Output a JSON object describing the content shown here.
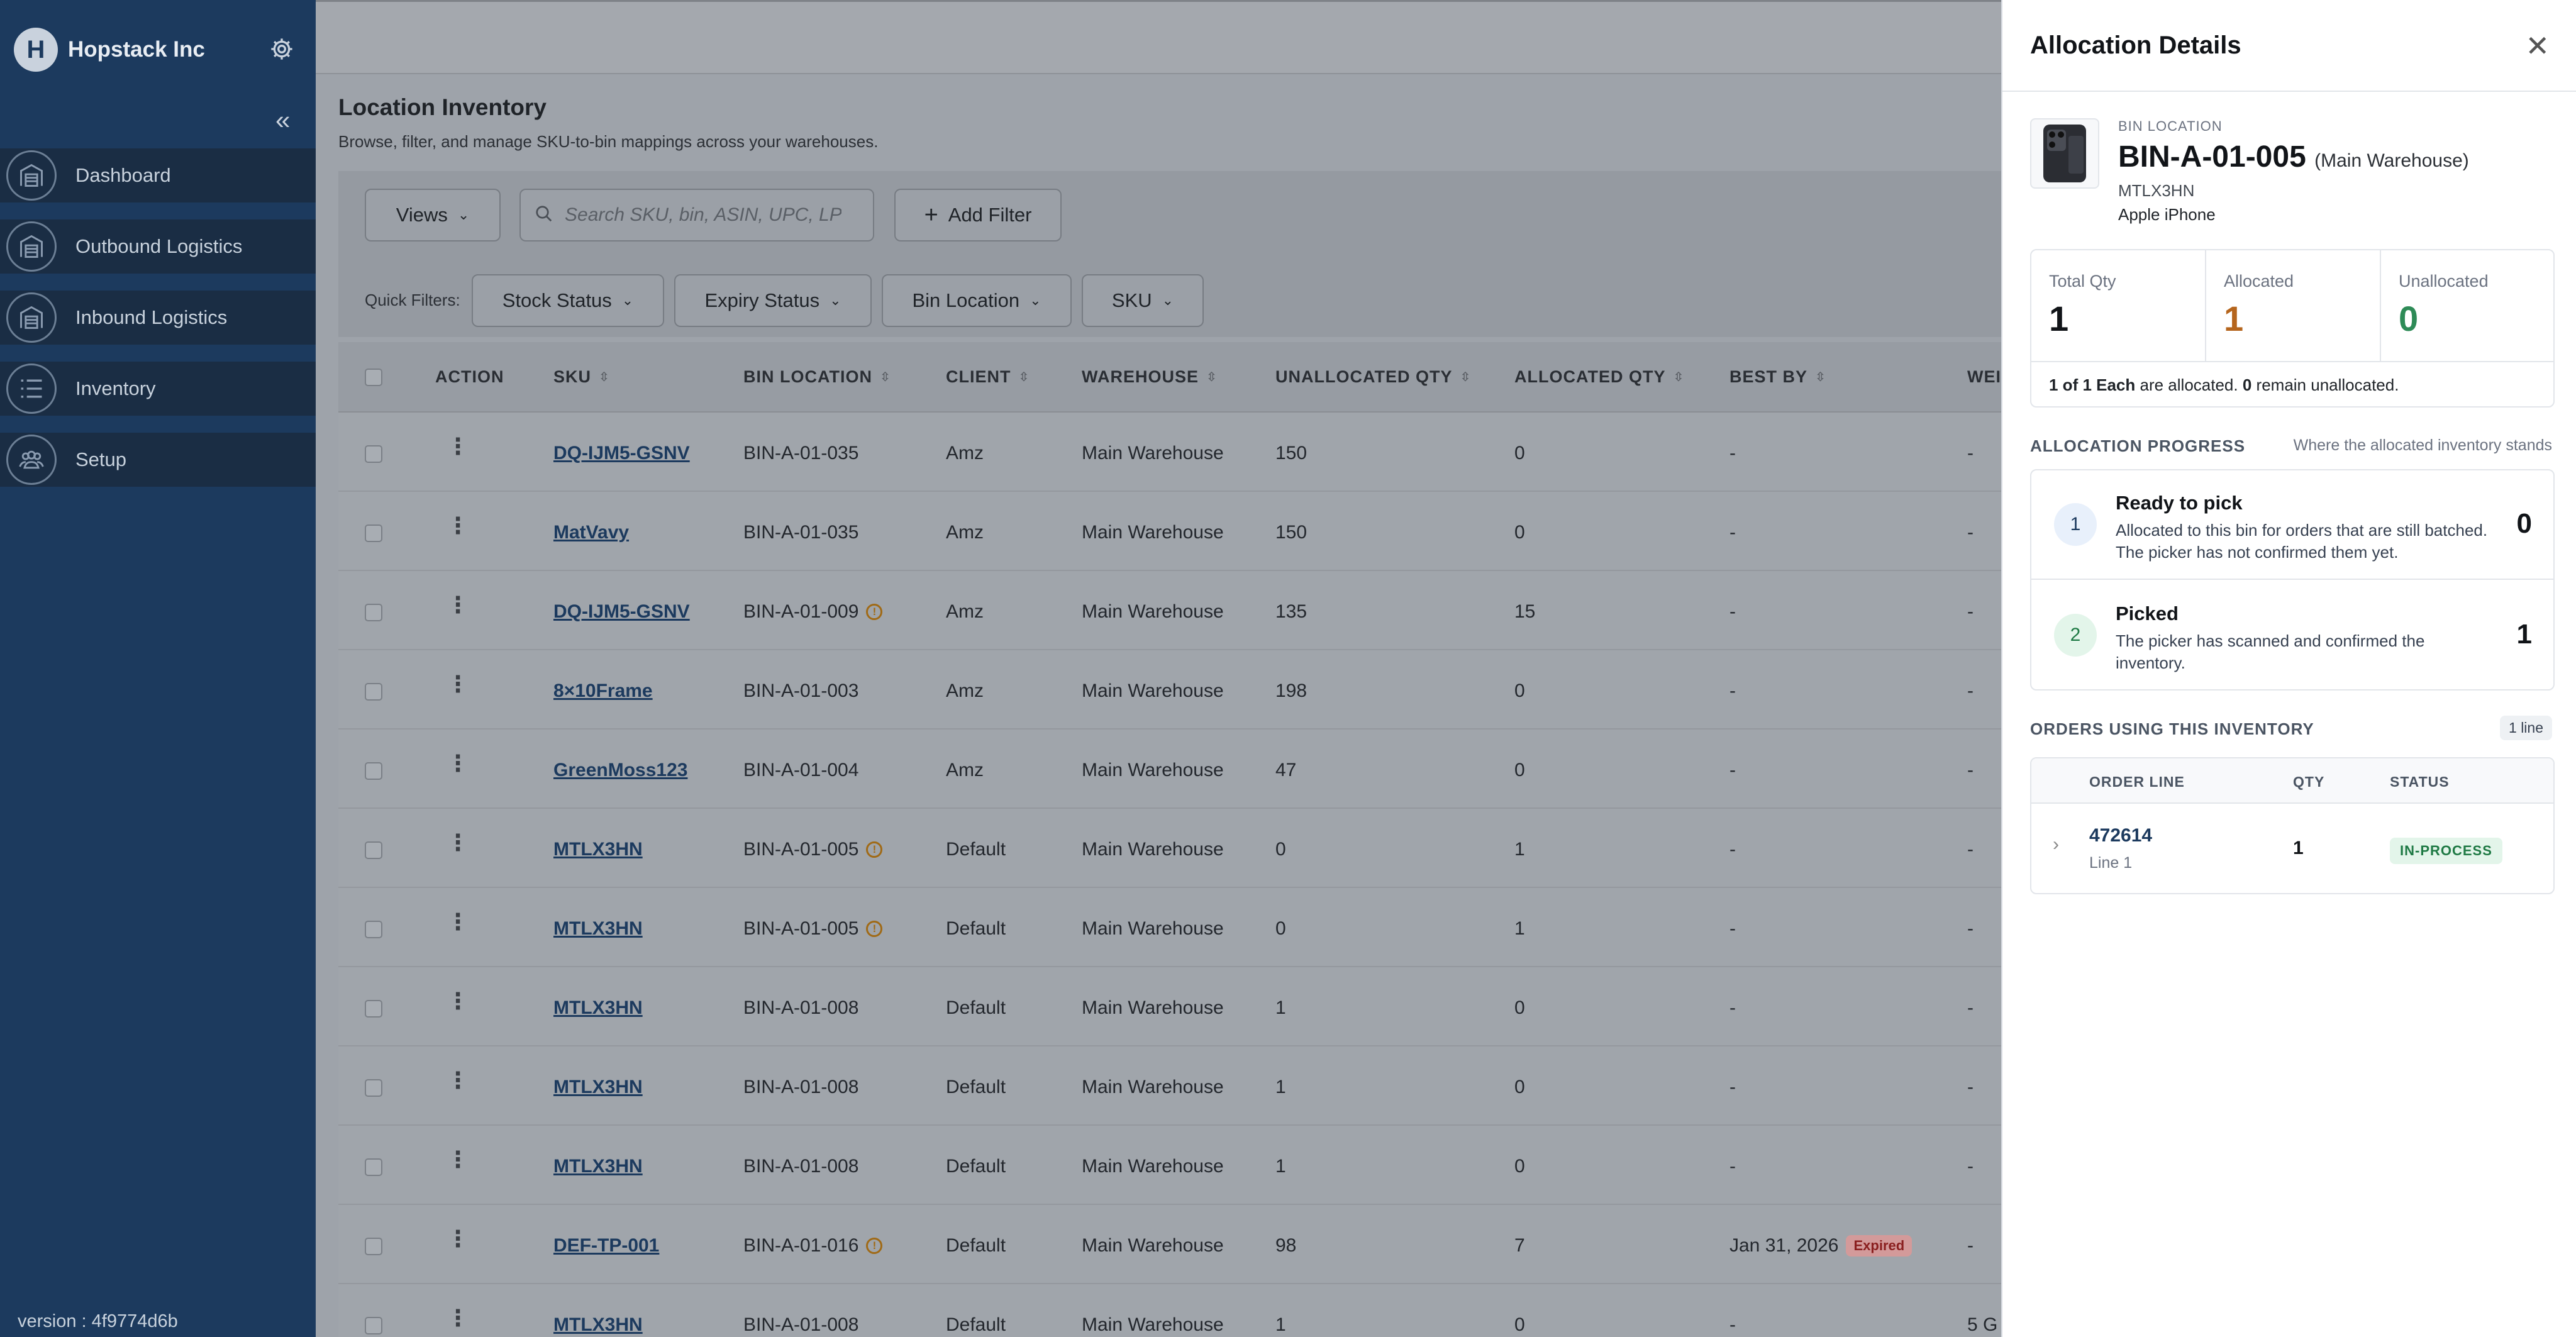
{
  "sidebar": {
    "brand": "Hopstack Inc",
    "logo_letter": "H",
    "items": [
      {
        "label": "Dashboard"
      },
      {
        "label": "Outbound Logistics"
      },
      {
        "label": "Inbound Logistics"
      },
      {
        "label": "Inventory"
      },
      {
        "label": "Setup"
      }
    ],
    "version": "version : 4f9774d6b"
  },
  "page": {
    "title": "Location Inventory",
    "subtitle": "Browse, filter, and manage SKU-to-bin mappings across your warehouses."
  },
  "toolbar": {
    "views_label": "Views",
    "search_placeholder": "Search SKU, bin, ASIN, UPC, LP",
    "add_filter_label": "Add Filter",
    "quick_filters_label": "Quick Filters:",
    "quick_filters": [
      "Stock Status",
      "Expiry Status",
      "Bin Location",
      "SKU"
    ]
  },
  "table": {
    "headers": {
      "action": "ACTION",
      "sku": "SKU",
      "bin": "BIN LOCATION",
      "client": "CLIENT",
      "warehouse": "WAREHOUSE",
      "unalloc": "UNALLOCATED QTY",
      "alloc": "ALLOCATED QTY",
      "bestby": "BEST BY",
      "weight": "WEIG"
    },
    "rows": [
      {
        "sku": "DQ-IJM5-GSNV",
        "bin": "BIN-A-01-035",
        "client": "Amz",
        "warehouse": "Main Warehouse",
        "unalloc": "150",
        "alloc": "0",
        "bestby": "-",
        "weight": "-"
      },
      {
        "sku": "MatVavy",
        "bin": "BIN-A-01-035",
        "client": "Amz",
        "warehouse": "Main Warehouse",
        "unalloc": "150",
        "alloc": "0",
        "bestby": "-",
        "weight": "-"
      },
      {
        "sku": "DQ-IJM5-GSNV",
        "bin": "BIN-A-01-009",
        "client": "Amz",
        "warehouse": "Main Warehouse",
        "unalloc": "135",
        "alloc": "15",
        "bestby": "-",
        "weight": "-"
      },
      {
        "sku": "8×10Frame",
        "bin": "BIN-A-01-003",
        "client": "Amz",
        "warehouse": "Main Warehouse",
        "unalloc": "198",
        "alloc": "0",
        "bestby": "-",
        "weight": "-"
      },
      {
        "sku": "GreenMoss123",
        "bin": "BIN-A-01-004",
        "client": "Amz",
        "warehouse": "Main Warehouse",
        "unalloc": "47",
        "alloc": "0",
        "bestby": "-",
        "weight": "-"
      },
      {
        "sku": "MTLX3HN",
        "bin": "BIN-A-01-005",
        "client": "Default",
        "warehouse": "Main Warehouse",
        "unalloc": "0",
        "alloc": "1",
        "bestby": "-",
        "weight": "-"
      },
      {
        "sku": "MTLX3HN",
        "bin": "BIN-A-01-005",
        "client": "Default",
        "warehouse": "Main Warehouse",
        "unalloc": "0",
        "alloc": "1",
        "bestby": "-",
        "weight": "-"
      },
      {
        "sku": "MTLX3HN",
        "bin": "BIN-A-01-008",
        "client": "Default",
        "warehouse": "Main Warehouse",
        "unalloc": "1",
        "alloc": "0",
        "bestby": "-",
        "weight": "-"
      },
      {
        "sku": "MTLX3HN",
        "bin": "BIN-A-01-008",
        "client": "Default",
        "warehouse": "Main Warehouse",
        "unalloc": "1",
        "alloc": "0",
        "bestby": "-",
        "weight": "-"
      },
      {
        "sku": "MTLX3HN",
        "bin": "BIN-A-01-008",
        "client": "Default",
        "warehouse": "Main Warehouse",
        "unalloc": "1",
        "alloc": "0",
        "bestby": "-",
        "weight": "-"
      },
      {
        "sku": "DEF-TP-001",
        "bin": "BIN-A-01-016",
        "client": "Default",
        "warehouse": "Main Warehouse",
        "unalloc": "98",
        "alloc": "7",
        "bestby": "Jan 31, 2026",
        "expired": "Expired",
        "weight": "-"
      },
      {
        "sku": "MTLX3HN",
        "bin": "BIN-A-01-008",
        "client": "Default",
        "warehouse": "Main Warehouse",
        "unalloc": "1",
        "alloc": "0",
        "bestby": "-",
        "weight": "5 G"
      }
    ]
  },
  "panel": {
    "title": "Allocation Details",
    "bin_label": "BIN LOCATION",
    "bin_code": "BIN-A-01-005",
    "warehouse": "(Main Warehouse)",
    "sku": "MTLX3HN",
    "product": "Apple iPhone",
    "stats": {
      "total_label": "Total Qty",
      "total": "1",
      "allocated_label": "Allocated",
      "allocated": "1",
      "unallocated_label": "Unallocated",
      "unallocated": "0",
      "summary_a": "1 of 1 Each",
      "summary_b": " are allocated. ",
      "summary_c": "0",
      "summary_d": " remain unallocated."
    },
    "progress": {
      "title": "ALLOCATION PROGRESS",
      "hint": "Where the allocated inventory stands",
      "steps": [
        {
          "num": "1",
          "title": "Ready to pick",
          "desc": "Allocated to this bin for orders that are still batched. The picker has not confirmed them yet.",
          "value": "0"
        },
        {
          "num": "2",
          "title": "Picked",
          "desc": "The picker has scanned and confirmed the inventory.",
          "value": "1"
        }
      ]
    },
    "orders": {
      "title": "ORDERS USING THIS INVENTORY",
      "badge": "1 line",
      "headers": {
        "line": "ORDER LINE",
        "qty": "QTY",
        "status": "STATUS"
      },
      "rows": [
        {
          "order": "472614",
          "line": "Line 1",
          "qty": "1",
          "status": "IN-PROCESS"
        }
      ]
    }
  },
  "colors": {
    "sidebar": "#1c3a5e",
    "allocated": "#b5651d",
    "unallocated": "#2e8b57",
    "expired": "#8a1f1f"
  }
}
